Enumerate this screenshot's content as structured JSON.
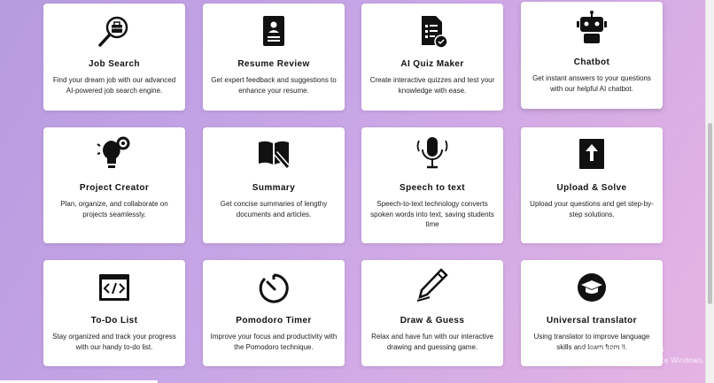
{
  "cards": [
    {
      "title": "Job Search",
      "desc": "Find your dream job with our advanced AI-powered job search engine.",
      "icon": "job-search-icon"
    },
    {
      "title": "Resume Review",
      "desc": "Get expert feedback and suggestions to enhance your resume.",
      "icon": "resume-icon"
    },
    {
      "title": "AI Quiz Maker",
      "desc": "Create interactive quizzes and test your knowledge with ease.",
      "icon": "quiz-icon"
    },
    {
      "title": "Chatbot",
      "desc": "Get instant answers to your questions with our helpful AI chatbot.",
      "icon": "robot-icon"
    },
    {
      "title": "Project Creator",
      "desc": "Plan, organize, and collaborate on projects seamlessly.",
      "icon": "lightbulb-gear-icon"
    },
    {
      "title": "Summary",
      "desc": "Get concise summaries of lengthy documents and articles.",
      "icon": "book-pen-icon"
    },
    {
      "title": "Speech to text",
      "desc": "Speech-to-text technology converts spoken words into text, saving students time",
      "icon": "microphone-icon"
    },
    {
      "title": "Upload & Solve",
      "desc": "Upload your questions and get step-by-step solutions.",
      "icon": "upload-icon"
    },
    {
      "title": "To-Do List",
      "desc": "Stay organized and track your progress with our handy to-do list.",
      "icon": "code-window-icon"
    },
    {
      "title": "Pomodoro Timer",
      "desc": "Improve your focus and productivity with the Pomodoro technique.",
      "icon": "timer-icon"
    },
    {
      "title": "Draw & Guess",
      "desc": "Relax and have fun with our interactive drawing and guessing game.",
      "icon": "pencil-icon"
    },
    {
      "title": "Universal translator",
      "desc": "Using translator to improve language skills and learn from it.",
      "icon": "graduation-cap-icon"
    }
  ],
  "watermark": {
    "line1": "Activate Windows",
    "line2": "Go to Settings to activate Windows."
  }
}
